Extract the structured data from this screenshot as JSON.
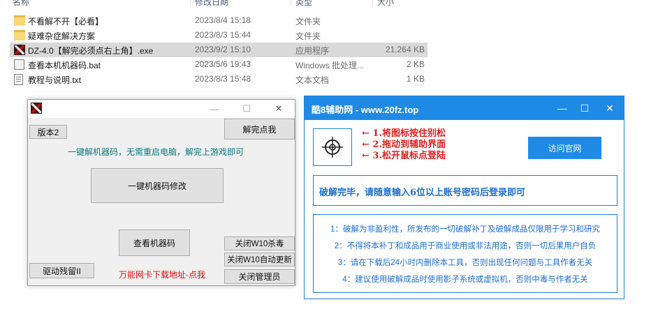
{
  "explorer": {
    "columns": {
      "name": "名称",
      "date": "修改日期",
      "type": "类型",
      "size": "大小"
    },
    "files": [
      {
        "name": "不看解不开【必看】",
        "date": "2023/8/4 15:18",
        "type": "文件夹",
        "size": "",
        "icon": "folder-icon"
      },
      {
        "name": "疑难杂症解决方案",
        "date": "2023/8/3 15:44",
        "type": "文件夹",
        "size": "",
        "icon": "folder-icon"
      },
      {
        "name": "DZ-4.0【解完必须点右上角】.exe",
        "date": "2023/9/2 15:10",
        "type": "应用程序",
        "size": "21,264 KB",
        "icon": "crosshair-app-icon"
      },
      {
        "name": "查看本机机器码.bat",
        "date": "2023/5/6 19:43",
        "type": "Windows 批处理...",
        "size": "2 KB",
        "icon": "batch-file-icon"
      },
      {
        "name": "教程与说明.txt",
        "date": "2023/8/3 15:48",
        "type": "文本文档",
        "size": "1 KB",
        "icon": "text-file-icon"
      }
    ]
  },
  "tool_window": {
    "icons": {
      "app": "crosshair-app-icon",
      "minimize": "—",
      "maximize": "☐",
      "close": "✕"
    },
    "version_button": "版本2",
    "unlock_button": "解完点我",
    "hint": "一键解机器码，无需重启电脑，解完上游戏即可",
    "modify_button": "一键机器码修改",
    "view_button": "查看机器码",
    "driver_button": "驱动残留II",
    "download_link": "万能网卡下载地址-点我",
    "disable_av_button": "关闭W10杀毒",
    "disable_update_button": "关闭W10自动更新",
    "close_admin_button": "关闭管理员",
    "colors": {
      "hint": "#0a7a82",
      "link": "#e01010"
    }
  },
  "assist_window": {
    "title": "酷8辅助网 - www.20fz.top",
    "icons": {
      "minimize": "—",
      "maximize": "☐",
      "close": "✕",
      "target": "crosshair-target-icon"
    },
    "steps": [
      "← 1.将图标按住别松",
      "← 2.拖动到辅助界面",
      "← 3.松开鼠标点登陆"
    ],
    "visit_button": "访问官网",
    "message": "破解完毕，请随意输入6位以上账号密码后登录即可",
    "notes": [
      "1：破解为非盈利性，所发布的一切破解补丁及破解成品仅限用于学习和研究",
      "2：不得将本补丁和成品用于商业使用或非法用途，否则一切后果用户自负",
      "3：请在下载后24小时内删除本工具，否则出现任何问题与工具作者无关",
      "4：建议使用破解成品时使用影子系统或虚拟机，否则中毒与作者无关"
    ],
    "colors": {
      "accent": "#1e8ae6",
      "steps": "#e02020",
      "notes": "#1e6fd0"
    }
  }
}
